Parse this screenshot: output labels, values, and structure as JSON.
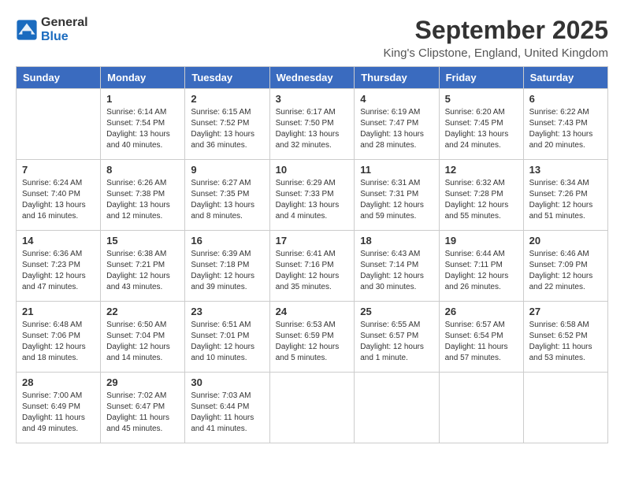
{
  "header": {
    "logo_line1": "General",
    "logo_line2": "Blue",
    "month": "September 2025",
    "location": "King's Clipstone, England, United Kingdom"
  },
  "weekdays": [
    "Sunday",
    "Monday",
    "Tuesday",
    "Wednesday",
    "Thursday",
    "Friday",
    "Saturday"
  ],
  "weeks": [
    [
      {
        "day": "",
        "info": ""
      },
      {
        "day": "1",
        "info": "Sunrise: 6:14 AM\nSunset: 7:54 PM\nDaylight: 13 hours\nand 40 minutes."
      },
      {
        "day": "2",
        "info": "Sunrise: 6:15 AM\nSunset: 7:52 PM\nDaylight: 13 hours\nand 36 minutes."
      },
      {
        "day": "3",
        "info": "Sunrise: 6:17 AM\nSunset: 7:50 PM\nDaylight: 13 hours\nand 32 minutes."
      },
      {
        "day": "4",
        "info": "Sunrise: 6:19 AM\nSunset: 7:47 PM\nDaylight: 13 hours\nand 28 minutes."
      },
      {
        "day": "5",
        "info": "Sunrise: 6:20 AM\nSunset: 7:45 PM\nDaylight: 13 hours\nand 24 minutes."
      },
      {
        "day": "6",
        "info": "Sunrise: 6:22 AM\nSunset: 7:43 PM\nDaylight: 13 hours\nand 20 minutes."
      }
    ],
    [
      {
        "day": "7",
        "info": "Sunrise: 6:24 AM\nSunset: 7:40 PM\nDaylight: 13 hours\nand 16 minutes."
      },
      {
        "day": "8",
        "info": "Sunrise: 6:26 AM\nSunset: 7:38 PM\nDaylight: 13 hours\nand 12 minutes."
      },
      {
        "day": "9",
        "info": "Sunrise: 6:27 AM\nSunset: 7:35 PM\nDaylight: 13 hours\nand 8 minutes."
      },
      {
        "day": "10",
        "info": "Sunrise: 6:29 AM\nSunset: 7:33 PM\nDaylight: 13 hours\nand 4 minutes."
      },
      {
        "day": "11",
        "info": "Sunrise: 6:31 AM\nSunset: 7:31 PM\nDaylight: 12 hours\nand 59 minutes."
      },
      {
        "day": "12",
        "info": "Sunrise: 6:32 AM\nSunset: 7:28 PM\nDaylight: 12 hours\nand 55 minutes."
      },
      {
        "day": "13",
        "info": "Sunrise: 6:34 AM\nSunset: 7:26 PM\nDaylight: 12 hours\nand 51 minutes."
      }
    ],
    [
      {
        "day": "14",
        "info": "Sunrise: 6:36 AM\nSunset: 7:23 PM\nDaylight: 12 hours\nand 47 minutes."
      },
      {
        "day": "15",
        "info": "Sunrise: 6:38 AM\nSunset: 7:21 PM\nDaylight: 12 hours\nand 43 minutes."
      },
      {
        "day": "16",
        "info": "Sunrise: 6:39 AM\nSunset: 7:18 PM\nDaylight: 12 hours\nand 39 minutes."
      },
      {
        "day": "17",
        "info": "Sunrise: 6:41 AM\nSunset: 7:16 PM\nDaylight: 12 hours\nand 35 minutes."
      },
      {
        "day": "18",
        "info": "Sunrise: 6:43 AM\nSunset: 7:14 PM\nDaylight: 12 hours\nand 30 minutes."
      },
      {
        "day": "19",
        "info": "Sunrise: 6:44 AM\nSunset: 7:11 PM\nDaylight: 12 hours\nand 26 minutes."
      },
      {
        "day": "20",
        "info": "Sunrise: 6:46 AM\nSunset: 7:09 PM\nDaylight: 12 hours\nand 22 minutes."
      }
    ],
    [
      {
        "day": "21",
        "info": "Sunrise: 6:48 AM\nSunset: 7:06 PM\nDaylight: 12 hours\nand 18 minutes."
      },
      {
        "day": "22",
        "info": "Sunrise: 6:50 AM\nSunset: 7:04 PM\nDaylight: 12 hours\nand 14 minutes."
      },
      {
        "day": "23",
        "info": "Sunrise: 6:51 AM\nSunset: 7:01 PM\nDaylight: 12 hours\nand 10 minutes."
      },
      {
        "day": "24",
        "info": "Sunrise: 6:53 AM\nSunset: 6:59 PM\nDaylight: 12 hours\nand 5 minutes."
      },
      {
        "day": "25",
        "info": "Sunrise: 6:55 AM\nSunset: 6:57 PM\nDaylight: 12 hours\nand 1 minute."
      },
      {
        "day": "26",
        "info": "Sunrise: 6:57 AM\nSunset: 6:54 PM\nDaylight: 11 hours\nand 57 minutes."
      },
      {
        "day": "27",
        "info": "Sunrise: 6:58 AM\nSunset: 6:52 PM\nDaylight: 11 hours\nand 53 minutes."
      }
    ],
    [
      {
        "day": "28",
        "info": "Sunrise: 7:00 AM\nSunset: 6:49 PM\nDaylight: 11 hours\nand 49 minutes."
      },
      {
        "day": "29",
        "info": "Sunrise: 7:02 AM\nSunset: 6:47 PM\nDaylight: 11 hours\nand 45 minutes."
      },
      {
        "day": "30",
        "info": "Sunrise: 7:03 AM\nSunset: 6:44 PM\nDaylight: 11 hours\nand 41 minutes."
      },
      {
        "day": "",
        "info": ""
      },
      {
        "day": "",
        "info": ""
      },
      {
        "day": "",
        "info": ""
      },
      {
        "day": "",
        "info": ""
      }
    ]
  ]
}
